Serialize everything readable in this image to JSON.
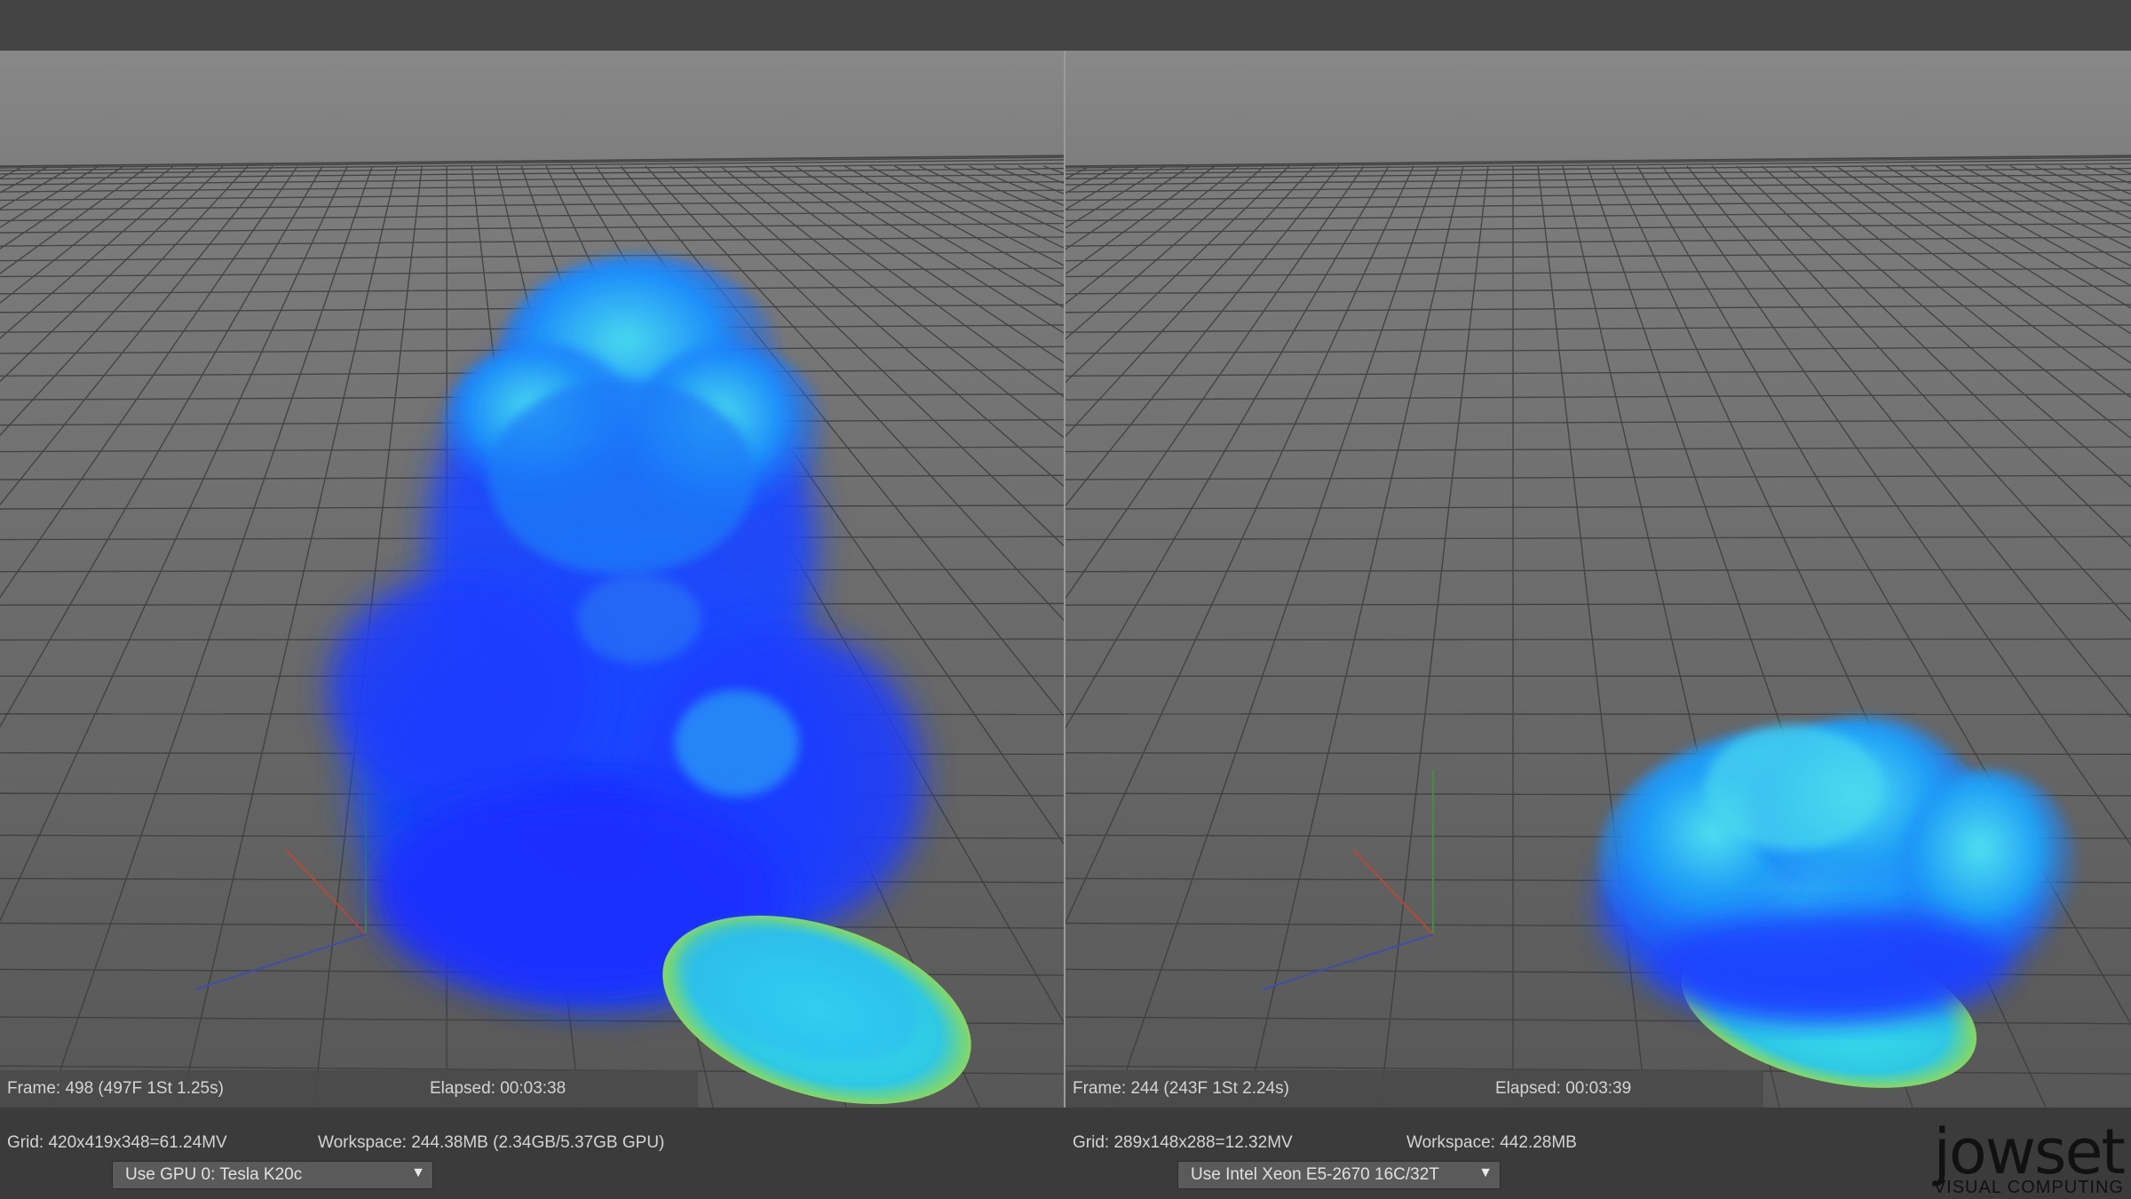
{
  "left_viewport": {
    "frame_text": "Frame: 498 (497F 1St 1.25s)",
    "elapsed_text": "Elapsed: 00:03:38",
    "grid_text": "Grid: 420x419x348=61.24MV",
    "workspace_text": "Workspace: 244.38MB (2.34GB/5.37GB GPU)",
    "device_value": "Use GPU 0: Tesla K20c"
  },
  "right_viewport": {
    "frame_text": "Frame: 244 (243F 1St 2.24s)",
    "elapsed_text": "Elapsed: 00:03:39",
    "grid_text": "Grid: 289x148x288=12.32MV",
    "workspace_text": "Workspace: 442.28MB",
    "device_value": "Use  Intel Xeon E5-2670 16C/32T"
  },
  "logo": {
    "wordmark": "jowset",
    "tagline": "VISUAL COMPUTING"
  },
  "icons": {
    "dropdown": "chevron-down-icon",
    "axis": "xyz-axis-gizmo-icon"
  },
  "colors": {
    "smoke_core": "#1a2cff",
    "smoke_mid": "#1565ff",
    "smoke_highlight": "#3fe0f2",
    "emitter_rim": "#7fd86a",
    "viewport_bg_top": "#8a8a8a",
    "viewport_bg_bottom": "#5a5a5a"
  }
}
